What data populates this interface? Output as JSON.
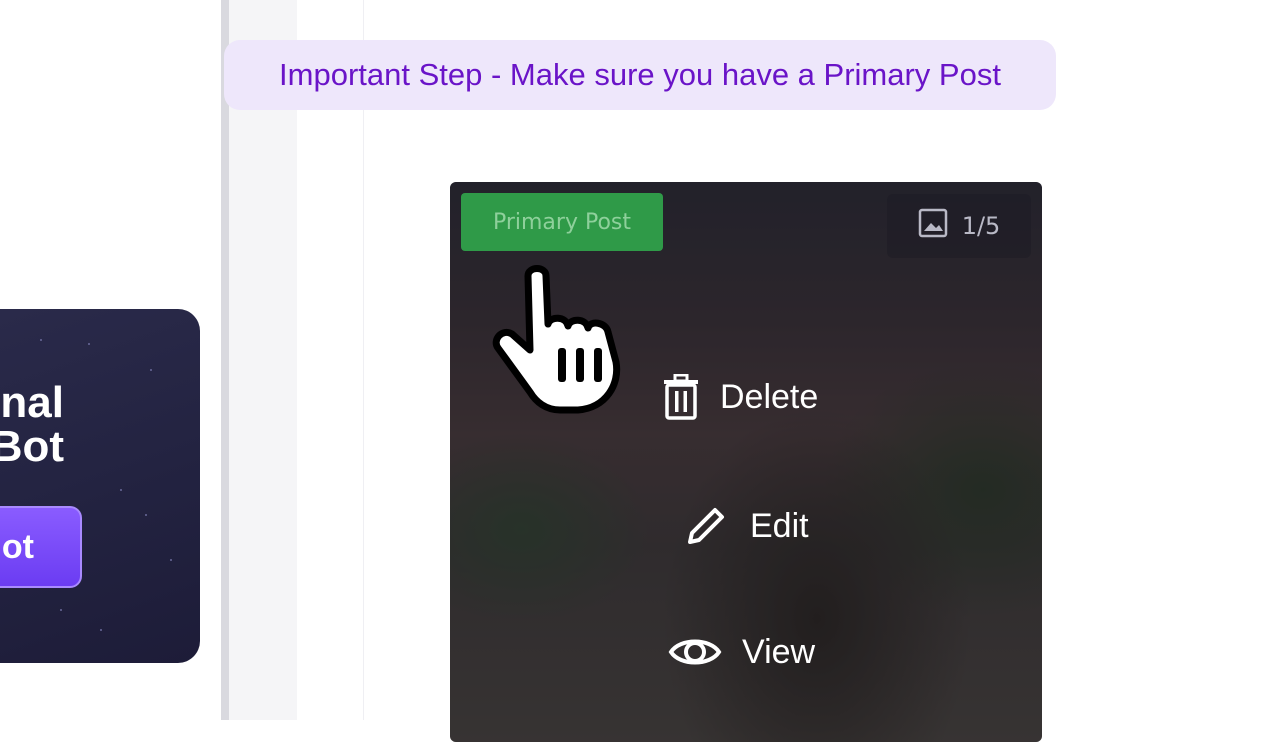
{
  "banner": {
    "text": "Important Step - Make sure you have a Primary Post"
  },
  "promo": {
    "title_line1": "nal",
    "title_line2": "Bot",
    "button_label": "ot"
  },
  "post": {
    "badge": "Primary Post",
    "image_count": "1/5",
    "actions": {
      "delete": "Delete",
      "edit": "Edit",
      "view": "View"
    }
  },
  "colors": {
    "banner_bg": "#eee7fb",
    "banner_text": "#6a14c8",
    "badge_green": "#2f9a48",
    "promo_button": "#7a4cff"
  },
  "icons": [
    "image-icon",
    "trash-icon",
    "pencil-icon",
    "eye-icon",
    "hand-pointer-cursor"
  ]
}
